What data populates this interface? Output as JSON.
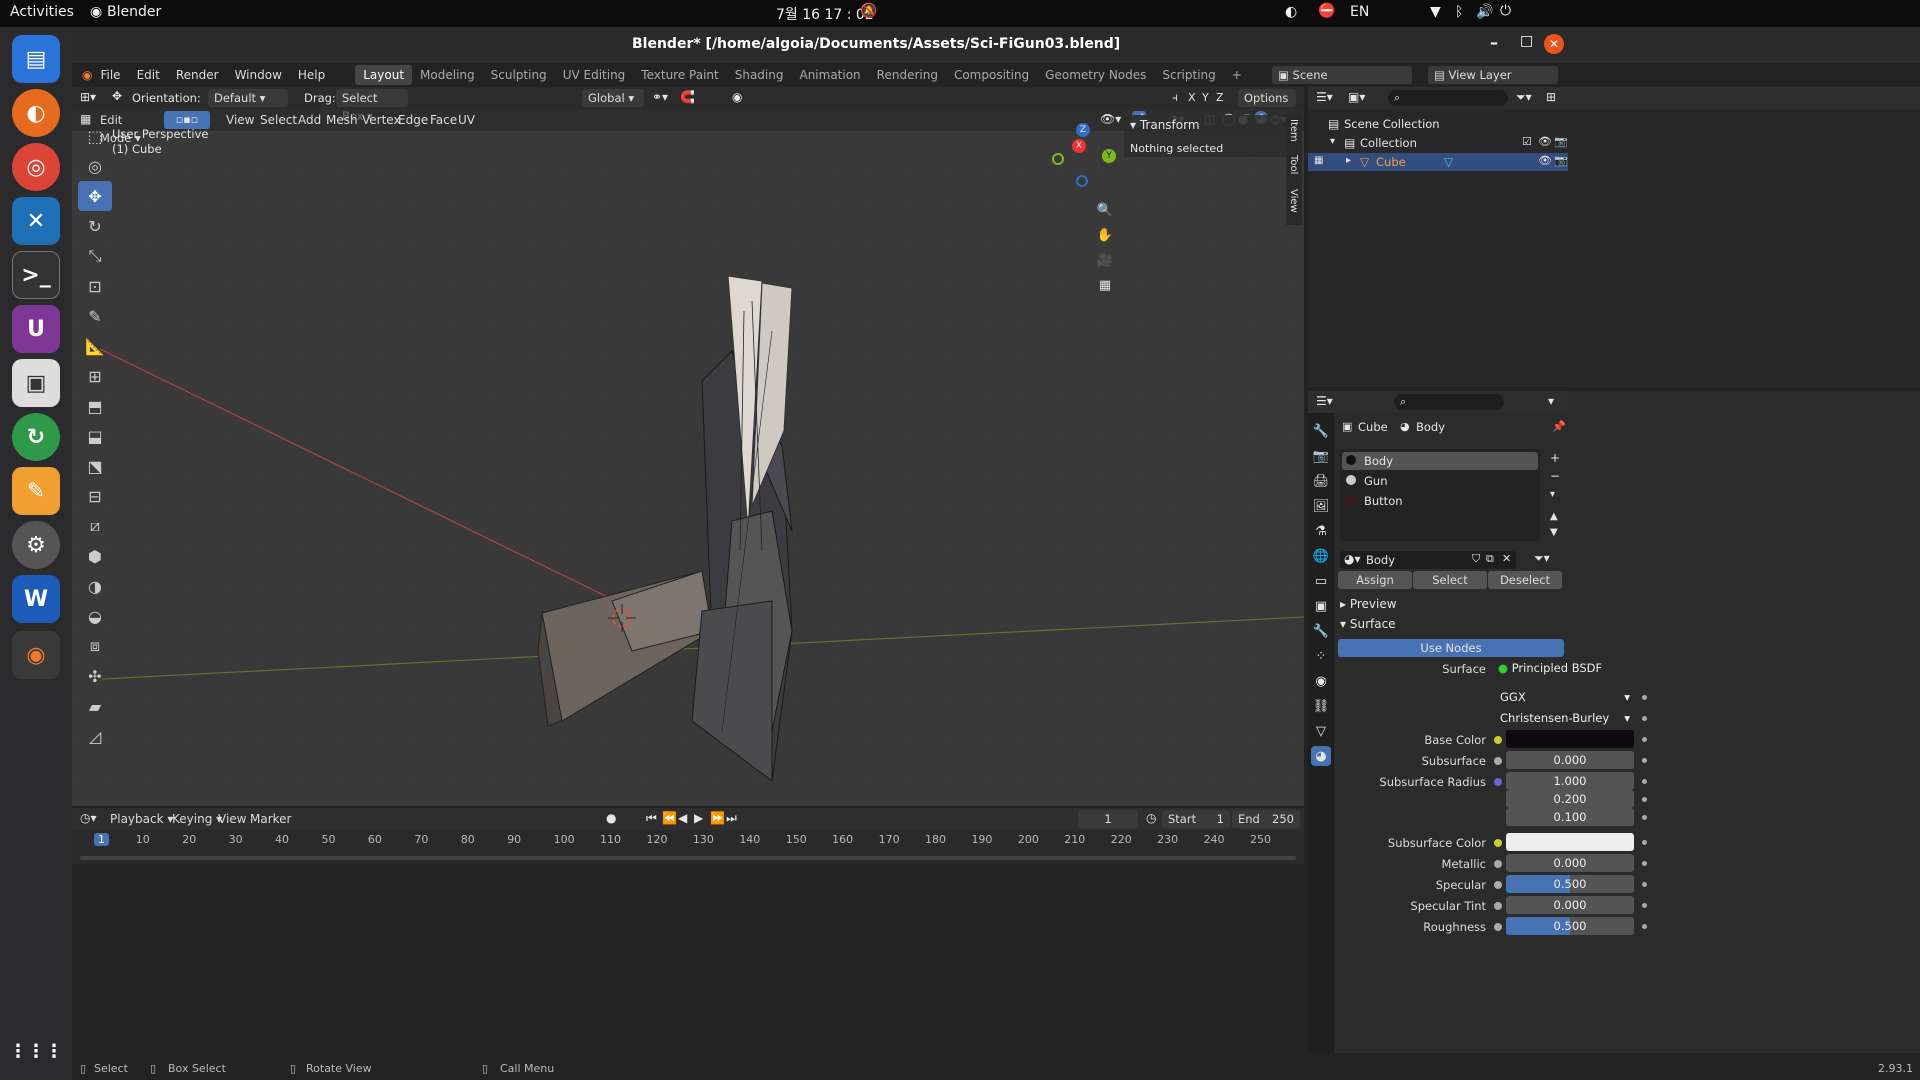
{
  "topbar": {
    "activities": "Activities",
    "app": "Blender",
    "clock": "7월 16  17 : 02",
    "lang": "EN"
  },
  "window": {
    "title": "Blender* [/home/algoia/Documents/Assets/Sci-FiGun03.blend]"
  },
  "menu": [
    "File",
    "Edit",
    "Render",
    "Window",
    "Help"
  ],
  "workspaces": [
    "Layout",
    "Modeling",
    "Sculpting",
    "UV Editing",
    "Texture Paint",
    "Shading",
    "Animation",
    "Rendering",
    "Compositing",
    "Geometry Nodes",
    "Scripting",
    "+"
  ],
  "scene": {
    "label": "Scene",
    "view_layer": "View Layer"
  },
  "toolheader": {
    "orientation_label": "Orientation:",
    "orientation_value": "Default",
    "drag_label": "Drag:",
    "drag_value": "Select Box",
    "transform": "Global",
    "options": "Options",
    "xyz": [
      "X",
      "Y",
      "Z"
    ]
  },
  "viewport_header": {
    "mode": "Edit Mode",
    "menus": [
      "View",
      "Select",
      "Add",
      "Mesh",
      "Vertex",
      "Edge",
      "Face",
      "UV"
    ]
  },
  "viewport": {
    "perspective": "User Perspective",
    "object": "(1) Cube"
  },
  "npanel": {
    "section": "Transform",
    "message": "Nothing selected",
    "tabs": [
      "Item",
      "Tool",
      "View"
    ]
  },
  "gizmo": {
    "x": "X",
    "y": "Y",
    "z": "Z"
  },
  "outliner": {
    "scene_collection": "Scene Collection",
    "collection": "Collection",
    "object": "Cube"
  },
  "properties": {
    "breadcrumb_object": "Cube",
    "breadcrumb_material": "Body",
    "slots": [
      "Body",
      "Gun",
      "Button"
    ],
    "material_name": "Body",
    "buttons": [
      "Assign",
      "Select",
      "Deselect"
    ],
    "preview": "Preview",
    "surface_section": "Surface",
    "use_nodes": "Use Nodes",
    "surface_label": "Surface",
    "surface_value": "Principled BSDF",
    "distribution": "GGX",
    "subsurface_method": "Christensen-Burley",
    "rows": [
      {
        "label": "Base Color",
        "value": ""
      },
      {
        "label": "Subsurface",
        "value": "0.000"
      },
      {
        "label": "Subsurface Radius",
        "value": "1.000"
      },
      {
        "label": "",
        "value": "0.200"
      },
      {
        "label": "",
        "value": "0.100"
      },
      {
        "label": "Subsurface Color",
        "value": ""
      },
      {
        "label": "Metallic",
        "value": "0.000"
      },
      {
        "label": "Specular",
        "value": "0.500"
      },
      {
        "label": "Specular Tint",
        "value": "0.000"
      },
      {
        "label": "Roughness",
        "value": "0.500"
      }
    ],
    "specular_fraction": 0.5,
    "roughness_fraction": 0.5
  },
  "timeline": {
    "menus": [
      "Playback",
      "Keying",
      "View",
      "Marker"
    ],
    "current_frame": "1",
    "start_label": "Start",
    "start": "1",
    "end_label": "End",
    "end": "250",
    "ticks": [
      "1",
      "10",
      "20",
      "30",
      "40",
      "50",
      "60",
      "70",
      "80",
      "90",
      "100",
      "110",
      "120",
      "130",
      "140",
      "150",
      "160",
      "170",
      "180",
      "190",
      "200",
      "210",
      "220",
      "230",
      "240",
      "250"
    ]
  },
  "statusbar": {
    "select": "Select",
    "box_select": "Box Select",
    "rotate": "Rotate View",
    "call_menu": "Call Menu",
    "version": "2.93.1"
  },
  "colors": {
    "accent": "#4772b3",
    "bg": "#303030",
    "header": "#232323"
  }
}
